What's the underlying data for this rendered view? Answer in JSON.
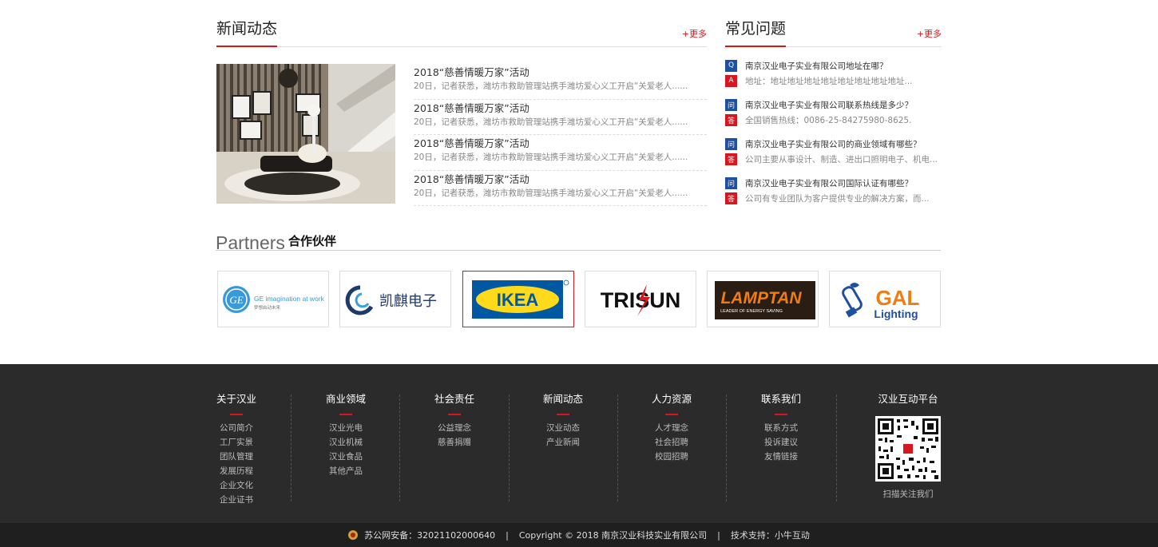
{
  "news": {
    "title": "新闻动态",
    "more": "+更多",
    "items": [
      {
        "title": "2018“慈善情暖万家”活动",
        "desc": "20日，记者获悉，潍坊市救助管理站携手潍坊爱心义工开启“关爱老人......"
      },
      {
        "title": "2018“慈善情暖万家”活动",
        "desc": "20日，记者获悉，潍坊市救助管理站携手潍坊爱心义工开启“关爱老人......"
      },
      {
        "title": "2018“慈善情暖万家”活动",
        "desc": "20日，记者获悉，潍坊市救助管理站携手潍坊爱心义工开启“关爱老人......"
      },
      {
        "title": "2018“慈善情暖万家”活动",
        "desc": "20日，记者获悉，潍坊市救助管理站携手潍坊爱心义工开启“关爱老人......"
      }
    ]
  },
  "faq": {
    "title": "常见问题",
    "more": "+更多",
    "items": [
      {
        "qtag": "Q",
        "atag": "A",
        "q": "南京汉业电子实业有限公司地址在哪？",
        "a": "地址：地址地址地址地址地址地址地址地址..."
      },
      {
        "qtag": "问",
        "atag": "答",
        "q": "南京汉业电子实业有限公司联系热线是多少？",
        "a": "全国销售热线：0086-25-84275980-8625."
      },
      {
        "qtag": "问",
        "atag": "答",
        "q": "南京汉业电子实业有限公司的商业领域有哪些？",
        "a": "公司主要从事设计、制造、进出口照明电子、机电..."
      },
      {
        "qtag": "问",
        "atag": "答",
        "q": "南京汉业电子实业有限公司国际认证有哪些？",
        "a": "公司有专业团队为客户提供专业的解决方案，而..."
      }
    ]
  },
  "partners": {
    "title_en": "Partners",
    "title_cn": "合作伙伴",
    "logos": [
      {
        "name": "GE",
        "text": "GE imagination at work",
        "sub": "梦想启动未来"
      },
      {
        "name": "凯麒电子",
        "text": "凯麒电子"
      },
      {
        "name": "IKEA",
        "text": "IKEA"
      },
      {
        "name": "TRISUN",
        "text": "TRISUN"
      },
      {
        "name": "LAMPTAN",
        "text": "LAMPTAN",
        "sub": "LEADER OF ENERGY SAVING"
      },
      {
        "name": "GAL Lighting",
        "text": "GAL",
        "sub": "Lighting"
      }
    ]
  },
  "footer": {
    "columns": [
      {
        "title": "关于汉业",
        "links": [
          "公司简介",
          "工厂实景",
          "团队管理",
          "发展历程",
          "企业文化",
          "企业证书"
        ]
      },
      {
        "title": "商业领域",
        "links": [
          "汉业光电",
          "汉业机械",
          "汉业食品",
          "其他产品"
        ]
      },
      {
        "title": "社会责任",
        "links": [
          "公益理念",
          "慈善捐赠"
        ]
      },
      {
        "title": "新闻动态",
        "links": [
          "汉业动态",
          "产业新闻"
        ]
      },
      {
        "title": "人力资源",
        "links": [
          "人才理念",
          "社会招聘",
          "校园招聘"
        ]
      },
      {
        "title": "联系我们",
        "links": [
          "联系方式",
          "投诉建议",
          "友情链接"
        ]
      }
    ],
    "qr": {
      "title": "汉业互动平台",
      "caption": "扫描关注我们"
    },
    "bottom": {
      "icp": "苏公网安备：32021102000640",
      "copyright": "Copyright © 2018  南京汉业科技实业有限公司",
      "support": "技术支持：小牛互动"
    }
  },
  "colors": {
    "accent": "#d7161d",
    "qtag": "#1e4fa0",
    "footer_bg": "#2b2b2b"
  }
}
